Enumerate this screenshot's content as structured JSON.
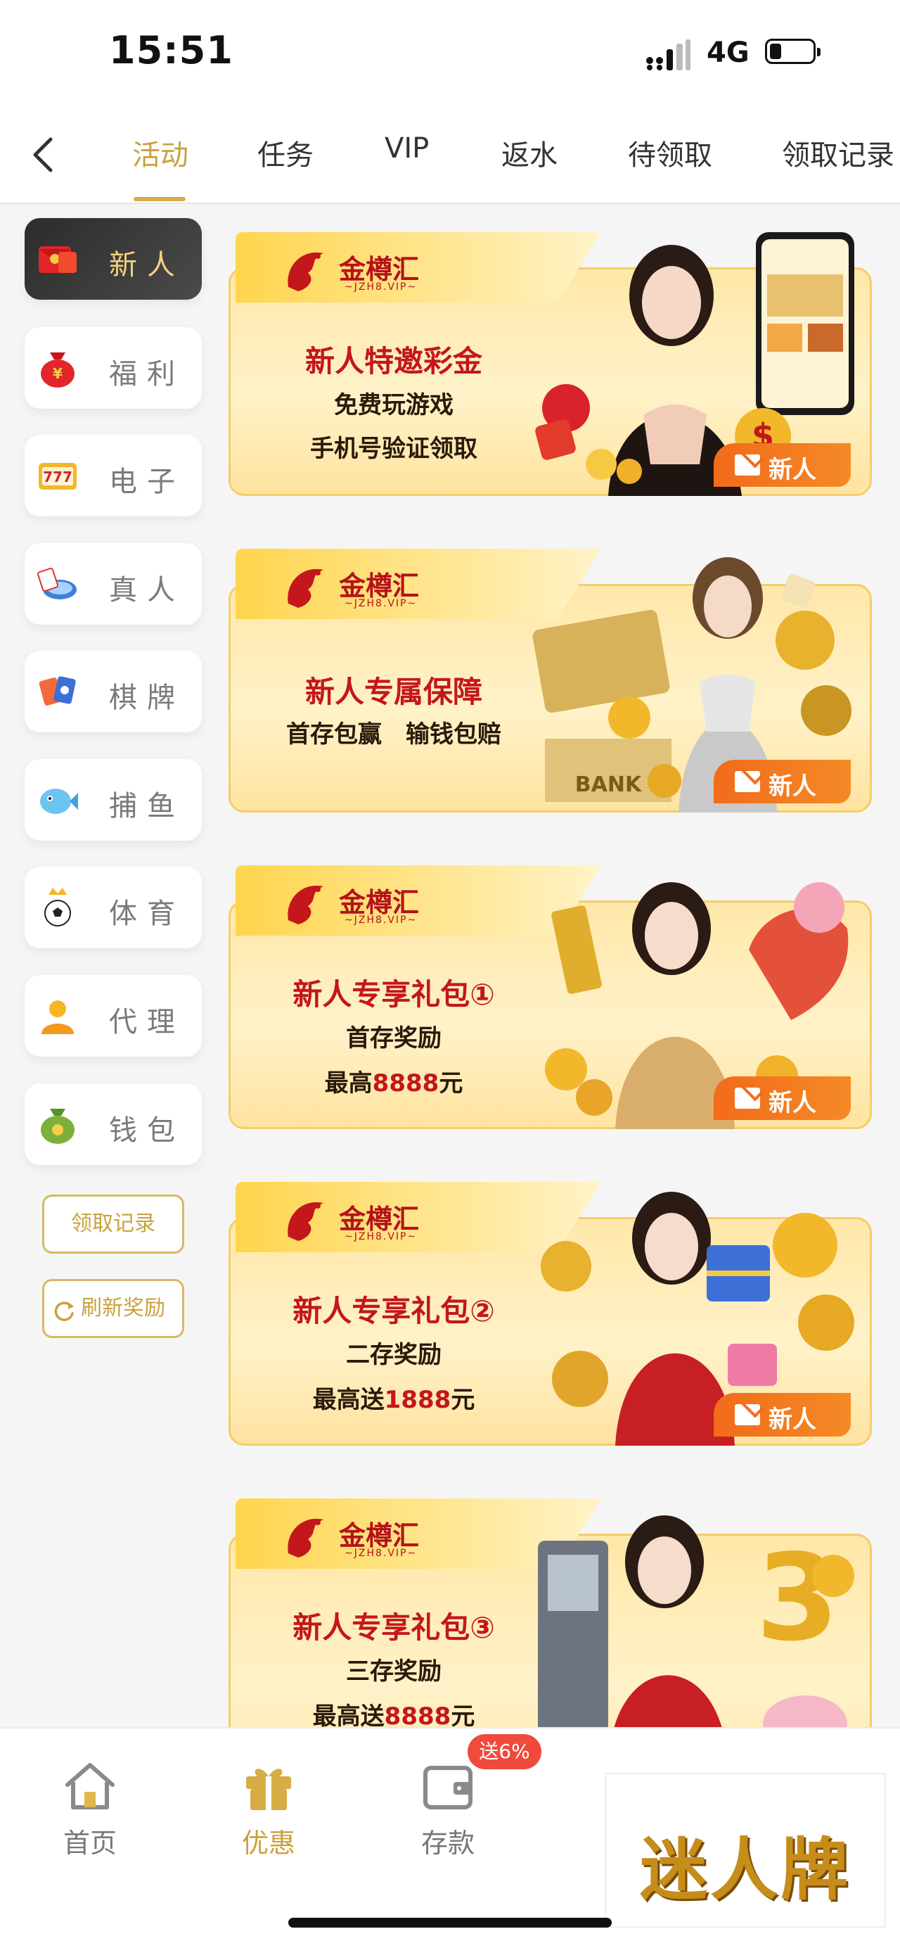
{
  "status": {
    "time": "15:51",
    "network": "4G"
  },
  "tabs": [
    {
      "label": "活动"
    },
    {
      "label": "任务"
    },
    {
      "label": "VIP"
    },
    {
      "label": "返水"
    },
    {
      "label": "待领取"
    },
    {
      "label": "领取记录"
    }
  ],
  "sidebar": {
    "items": [
      {
        "label": "新人",
        "icon": "red-envelope-icon"
      },
      {
        "label": "福利",
        "icon": "money-bag-icon"
      },
      {
        "label": "电子",
        "icon": "slot-777-icon"
      },
      {
        "label": "真人",
        "icon": "live-dealer-icon"
      },
      {
        "label": "棋牌",
        "icon": "cards-icon"
      },
      {
        "label": "捕鱼",
        "icon": "fish-icon"
      },
      {
        "label": "体育",
        "icon": "soccer-icon"
      },
      {
        "label": "代理",
        "icon": "agent-icon"
      },
      {
        "label": "钱包",
        "icon": "wallet-icon"
      }
    ],
    "record_button": "领取记录",
    "refresh_button": "刷新奖励"
  },
  "banners": [
    {
      "brand": "金樽汇",
      "brand_sub": "~JZH8.VIP~",
      "title": "新人特邀彩金",
      "line1": "免费玩游戏",
      "line2": "手机号验证领取",
      "badge": "新人"
    },
    {
      "brand": "金樽汇",
      "brand_sub": "~JZH8.VIP~",
      "title": "新人专属保障",
      "line1": "首存包赢　输钱包赔",
      "badge": "新人"
    },
    {
      "brand": "金樽汇",
      "brand_sub": "~JZH8.VIP~",
      "title": "新人专享礼包①",
      "line1": "首存奖励",
      "line2_prefix": "最高",
      "line2_amount": "8888",
      "line2_suffix": "元",
      "badge": "新人"
    },
    {
      "brand": "金樽汇",
      "brand_sub": "~JZH8.VIP~",
      "title": "新人专享礼包②",
      "line1": "二存奖励",
      "line2_prefix": "最高送",
      "line2_amount": "1888",
      "line2_suffix": "元",
      "badge": "新人"
    },
    {
      "brand": "金樽汇",
      "brand_sub": "~JZH8.VIP~",
      "title": "新人专享礼包③",
      "line1": "三存奖励",
      "line2_prefix": "最高送",
      "line2_amount": "8888",
      "line2_suffix": "元"
    }
  ],
  "bottom_nav": [
    {
      "label": "首页",
      "icon": "home-icon"
    },
    {
      "label": "优惠",
      "icon": "gift-icon"
    },
    {
      "label": "存款",
      "icon": "wallet-icon"
    }
  ],
  "deposit_badge": "送6%",
  "watermark": "迷人牌"
}
